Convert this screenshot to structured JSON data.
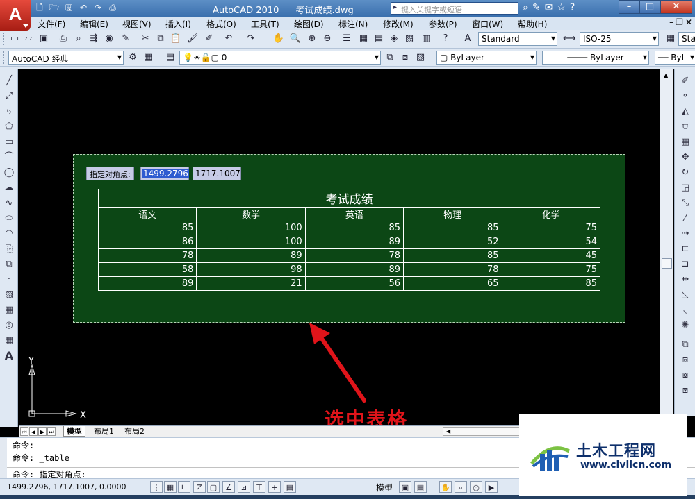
{
  "app": {
    "logo": "A",
    "title": "AutoCAD 2010",
    "filename": "考试成绩.dwg",
    "search_placeholder": "键入关键字或短语"
  },
  "menu": [
    "文件(F)",
    "编辑(E)",
    "视图(V)",
    "插入(I)",
    "格式(O)",
    "工具(T)",
    "绘图(D)",
    "标注(N)",
    "修改(M)",
    "参数(P)",
    "窗口(W)",
    "帮助(H)"
  ],
  "toolbar": {
    "text_style": "Standard",
    "dim_style": "ISO-25",
    "table_style": "Sta",
    "workspace": "AutoCAD 经典",
    "layer": "0",
    "color": "ByLayer",
    "linetype": "ByLayer",
    "lineweight": "ByL"
  },
  "dynamic_input": {
    "prompt": "指定对角点:",
    "x": "1499.2796",
    "y": "1717.1007"
  },
  "table": {
    "title": "考试成绩",
    "headers": [
      "语文",
      "数学",
      "英语",
      "物理",
      "化学"
    ],
    "rows": [
      [
        "85",
        "100",
        "85",
        "85",
        "75"
      ],
      [
        "86",
        "100",
        "89",
        "52",
        "54"
      ],
      [
        "78",
        "89",
        "78",
        "85",
        "45"
      ],
      [
        "58",
        "98",
        "89",
        "78",
        "75"
      ],
      [
        "89",
        "21",
        "56",
        "65",
        "85"
      ]
    ]
  },
  "ucs": {
    "x_label": "X",
    "y_label": "Y"
  },
  "annotation": {
    "text": "选中表格",
    "color": "#e0141a"
  },
  "tabs": [
    "模型",
    "布局1",
    "布局2"
  ],
  "command": {
    "line1": "命令:",
    "line2": "命令:  _table",
    "line3": "命令:  指定对角点:"
  },
  "status": {
    "coords": "1499.2796,  1717.1007, 0.0000",
    "model": "模型"
  },
  "watermark": {
    "name": "土木工程网",
    "url": "www.civilcn.com"
  },
  "colors": {
    "selection_fill": "#0c4715",
    "canvas": "#000000",
    "title_bar": "#3a6fae"
  }
}
